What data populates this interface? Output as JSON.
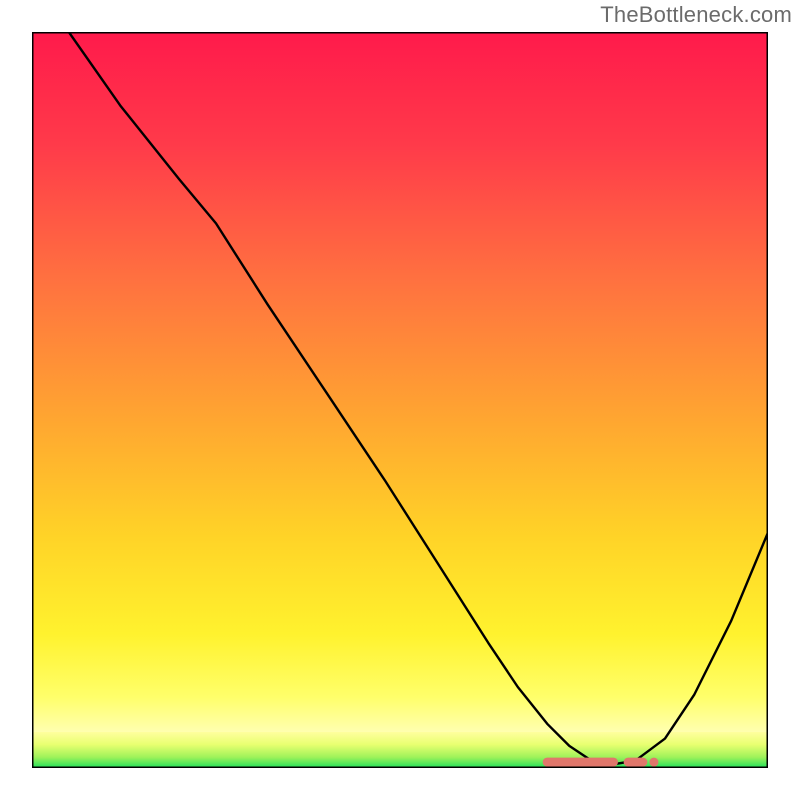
{
  "watermark": "TheBottleneck.com",
  "colors": {
    "curve": "#000000",
    "marker": "#e0776b",
    "frame": "#000000"
  },
  "chart_data": {
    "type": "line",
    "title": "",
    "xlabel": "",
    "ylabel": "",
    "xlim": [
      0,
      100
    ],
    "ylim": [
      0,
      100
    ],
    "grid": false,
    "legend": false,
    "series": [
      {
        "name": "bottleneck-curve",
        "x": [
          5,
          12,
          20,
          25,
          32,
          40,
          48,
          55,
          62,
          66,
          70,
          73,
          76,
          79,
          82,
          86,
          90,
          95,
          100
        ],
        "y": [
          100,
          90,
          80,
          74,
          63,
          51,
          39,
          28,
          17,
          11,
          6,
          3,
          1,
          0.5,
          1,
          4,
          10,
          20,
          32
        ]
      }
    ],
    "markers": {
      "name": "optimal-range",
      "y_value": 0.8,
      "x_start": 70,
      "x_end": 83,
      "gap_start": 79,
      "gap_end": 81
    }
  }
}
